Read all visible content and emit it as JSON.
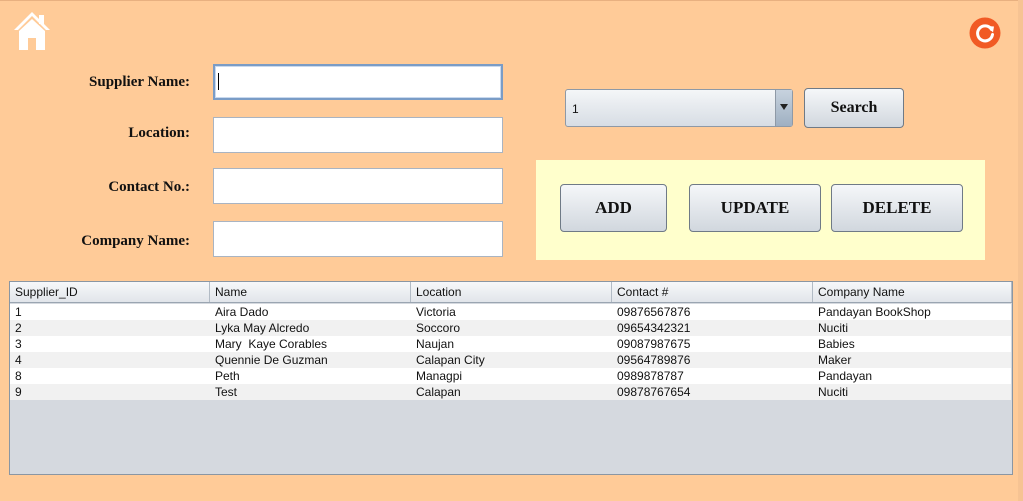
{
  "form": {
    "supplier_name_label": "Supplier Name:",
    "supplier_name_value": "",
    "location_label": "Location:",
    "location_value": "",
    "contact_label": "Contact No.:",
    "contact_value": "",
    "company_label": "Company Name:",
    "company_value": ""
  },
  "search": {
    "selected": "1",
    "button_label": "Search"
  },
  "actions": {
    "add_label": "ADD",
    "update_label": "UPDATE",
    "delete_label": "DELETE"
  },
  "table": {
    "headers": [
      "Supplier_ID",
      "Name",
      "Location",
      "Contact #",
      "Company Name"
    ],
    "rows": [
      [
        "1",
        "Aira Dado",
        "Victoria",
        "09876567876",
        "Pandayan BookShop"
      ],
      [
        "2",
        "Lyka May Alcredo",
        "Soccoro",
        "09654342321",
        "Nuciti"
      ],
      [
        "3",
        "Mary  Kaye Corables",
        "Naujan",
        "09087987675",
        "Babies"
      ],
      [
        "4",
        "Quennie De Guzman",
        "Calapan City",
        "09564789876",
        "Maker"
      ],
      [
        "8",
        "Peth",
        "Managpi",
        "0989878787",
        "Pandayan"
      ],
      [
        "9",
        "Test",
        "Calapan",
        "09878767654",
        "Nuciti"
      ]
    ]
  },
  "icons": {
    "home": "home-icon",
    "refresh": "refresh-icon"
  },
  "colors": {
    "background": "#ffcb98",
    "action_panel": "#ffffcc",
    "refresh_accent": "#f15a24"
  }
}
